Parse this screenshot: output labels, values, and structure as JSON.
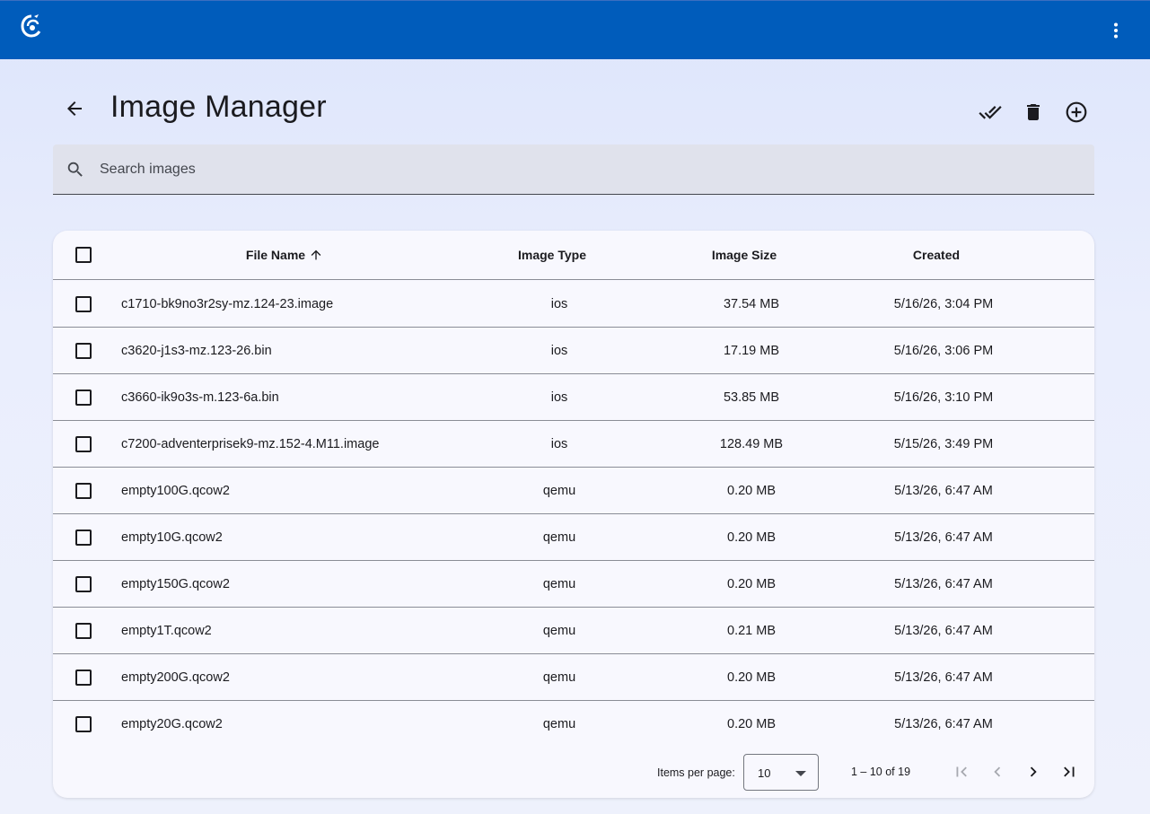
{
  "page": {
    "title": "Image Manager",
    "search_placeholder": "Search images"
  },
  "actions": [
    "select-all-icon",
    "delete-icon",
    "add-circle-icon"
  ],
  "table": {
    "columns": [
      "File Name",
      "Image Type",
      "Image Size",
      "Created"
    ],
    "sort": {
      "column": "File Name",
      "direction": "ascending"
    },
    "rows": [
      {
        "name": "c1710-bk9no3r2sy-mz.124-23.image",
        "type": "ios",
        "size": "37.54 MB",
        "created": "5/16/26, 3:04 PM"
      },
      {
        "name": "c3620-j1s3-mz.123-26.bin",
        "type": "ios",
        "size": "17.19 MB",
        "created": "5/16/26, 3:06 PM"
      },
      {
        "name": "c3660-ik9o3s-m.123-6a.bin",
        "type": "ios",
        "size": "53.85 MB",
        "created": "5/16/26, 3:10 PM"
      },
      {
        "name": "c7200-adventerprisek9-mz.152-4.M11.image",
        "type": "ios",
        "size": "128.49 MB",
        "created": "5/15/26, 3:49 PM"
      },
      {
        "name": "empty100G.qcow2",
        "type": "qemu",
        "size": "0.20 MB",
        "created": "5/13/26, 6:47 AM"
      },
      {
        "name": "empty10G.qcow2",
        "type": "qemu",
        "size": "0.20 MB",
        "created": "5/13/26, 6:47 AM"
      },
      {
        "name": "empty150G.qcow2",
        "type": "qemu",
        "size": "0.20 MB",
        "created": "5/13/26, 6:47 AM"
      },
      {
        "name": "empty1T.qcow2",
        "type": "qemu",
        "size": "0.21 MB",
        "created": "5/13/26, 6:47 AM"
      },
      {
        "name": "empty200G.qcow2",
        "type": "qemu",
        "size": "0.20 MB",
        "created": "5/13/26, 6:47 AM"
      },
      {
        "name": "empty20G.qcow2",
        "type": "qemu",
        "size": "0.20 MB",
        "created": "5/13/26, 6:47 AM"
      }
    ]
  },
  "paginator": {
    "items_per_page_label": "Items per page:",
    "items_per_page": "10",
    "range": "1 – 10 of 19"
  },
  "colors": {
    "topbar": "#005cbb",
    "background": "#e8ecfc",
    "card": "#f8f8fe",
    "search_bg": "#e0e2ec"
  }
}
